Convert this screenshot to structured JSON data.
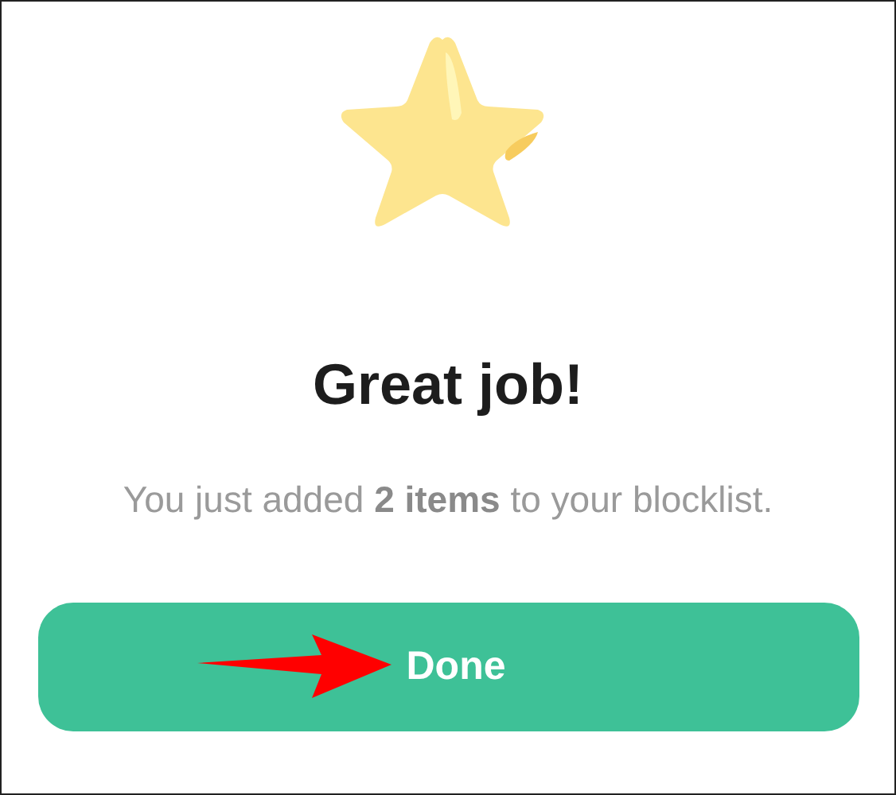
{
  "title": "Great job!",
  "message": "You just added **2 items** to your blocklist.",
  "button": {
    "label": "Done"
  }
}
